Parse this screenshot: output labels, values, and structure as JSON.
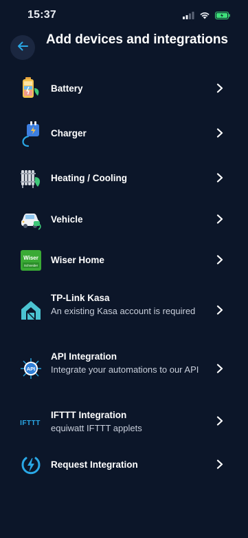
{
  "status_bar": {
    "time": "15:37"
  },
  "header": {
    "title": "Add devices and integrations"
  },
  "items": [
    {
      "title": "Battery"
    },
    {
      "title": "Charger"
    },
    {
      "title": "Heating / Cooling"
    },
    {
      "title": "Vehicle"
    },
    {
      "title": "Wiser Home",
      "icon_text": "Wiser",
      "icon_subtext": "Schneider"
    },
    {
      "title": "TP-Link Kasa",
      "subtitle": "An existing Kasa account is required"
    },
    {
      "title": "API Integration",
      "subtitle": "Integrate your automations to our API",
      "icon_text": "API"
    },
    {
      "title": "IFTTT Integration",
      "subtitle": "equiwatt IFTTT applets",
      "icon_text": "IFTTT"
    },
    {
      "title": "Request Integration"
    }
  ],
  "colors": {
    "background": "#0c1629",
    "accent": "#2aa8e6",
    "battery_status": "#3ee07a"
  }
}
